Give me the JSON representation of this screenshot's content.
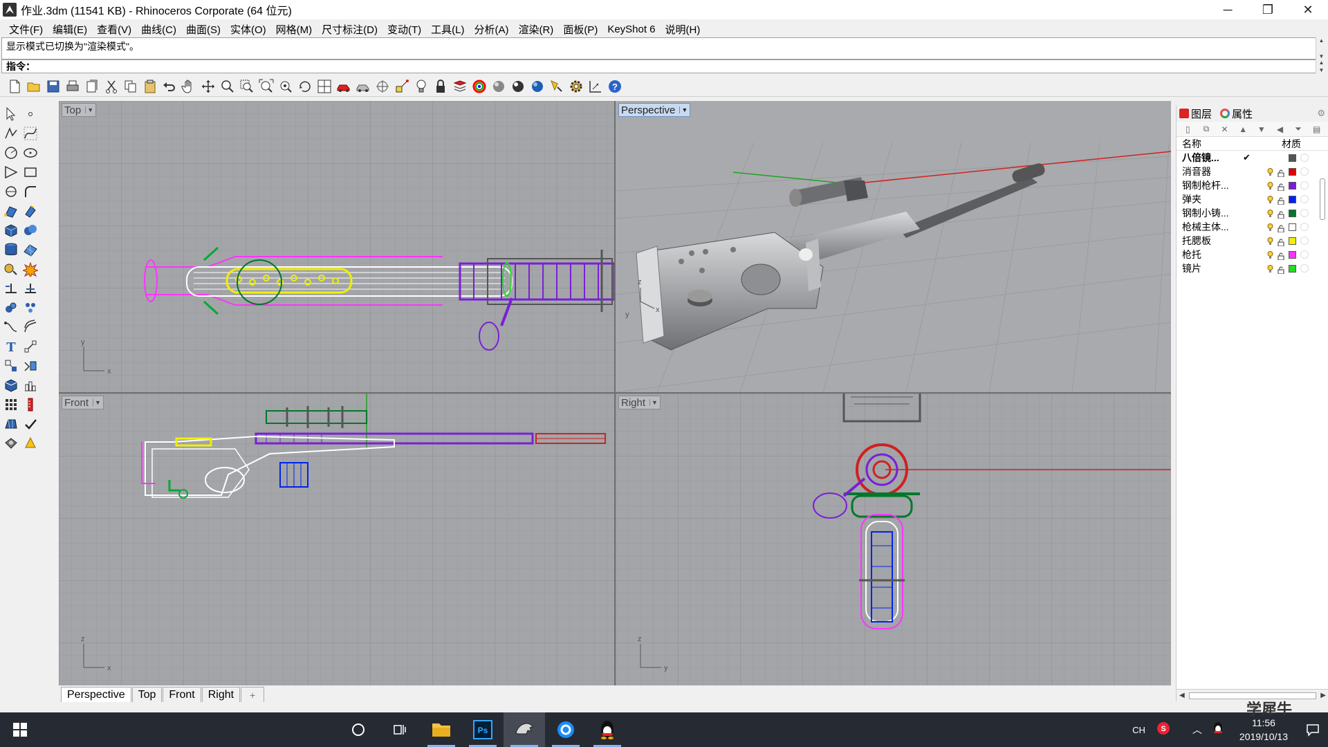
{
  "window": {
    "title": "作业.3dm (11541 KB) - Rhinoceros Corporate (64 位元)",
    "minimize": "─",
    "restore": "❐",
    "close": "✕"
  },
  "menu": [
    "文件(F)",
    "编辑(E)",
    "查看(V)",
    "曲线(C)",
    "曲面(S)",
    "实体(O)",
    "网格(M)",
    "尺寸标注(D)",
    "变动(T)",
    "工具(L)",
    "分析(A)",
    "渲染(R)",
    "面板(P)",
    "KeyShot 6",
    "说明(H)"
  ],
  "command": {
    "history": "显示模式已切换为\"渲染模式\"。",
    "prompt": "指令：",
    "value": ""
  },
  "viewports": {
    "top": "Top",
    "perspective": "Perspective",
    "front": "Front",
    "right": "Right"
  },
  "viewport_tabs": [
    "Perspective",
    "Top",
    "Front",
    "Right"
  ],
  "viewport_tab_add": "+",
  "panel": {
    "tab_layers": "图层",
    "tab_properties": "属性",
    "col_name": "名称",
    "col_material": "材质",
    "layers": [
      {
        "name": "八倍镜...",
        "current": "✔",
        "color": "#555555",
        "bold": true
      },
      {
        "name": "消音器",
        "color": "#e00000"
      },
      {
        "name": "钢制枪杆...",
        "color": "#7a1fd6"
      },
      {
        "name": "弹夹",
        "color": "#0022ee"
      },
      {
        "name": "钢制小铸...",
        "color": "#00772a"
      },
      {
        "name": "枪械主体...",
        "color": "#ffffff"
      },
      {
        "name": "托腮板",
        "color": "#f0f000"
      },
      {
        "name": "枪托",
        "color": "#ff33ff"
      },
      {
        "name": "镜片",
        "color": "#22dd22"
      }
    ]
  },
  "taskbar": {
    "ime": "CH",
    "time": "11:56",
    "date": "2019/10/13",
    "apps": [
      "search",
      "task-view",
      "file-explorer",
      "photoshop",
      "rhino",
      "browser",
      "qq"
    ]
  },
  "watermark": "学犀牛"
}
